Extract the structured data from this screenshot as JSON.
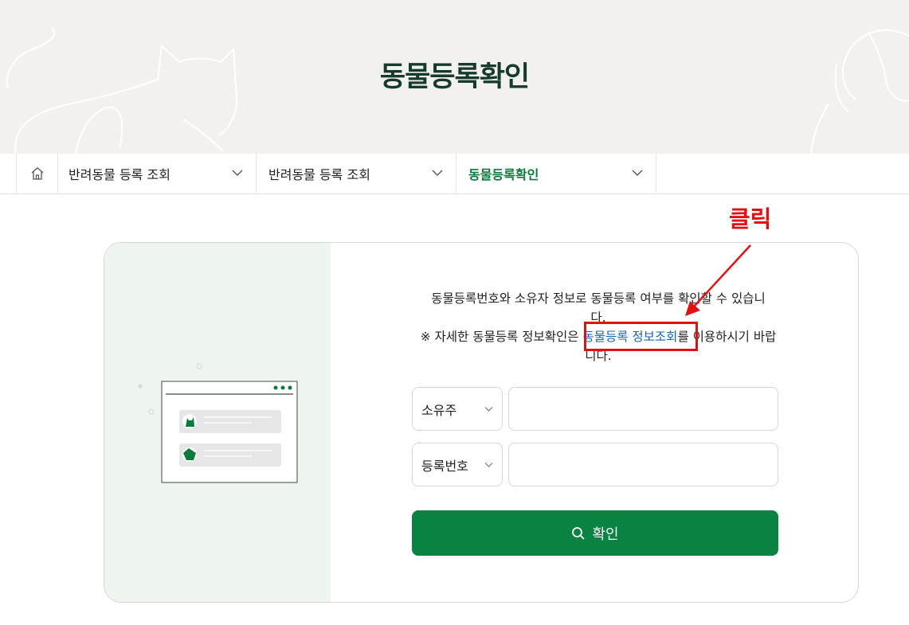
{
  "hero": {
    "title": "동물등록확인"
  },
  "breadcrumb": {
    "items": [
      {
        "label": "반려동물 등록 조회"
      },
      {
        "label": "반려동물 등록 조회"
      },
      {
        "label": "동물등록확인"
      }
    ]
  },
  "annotation": {
    "label": "클릭"
  },
  "card": {
    "description_line1": "동물등록번호와 소유자 정보로 동물등록 여부를 확인할 수 있습니다.",
    "description_prefix": "※ 자세한 동물등록 정보확인은 ",
    "description_link": "동물등록 정보조회",
    "description_suffix": "를 이용하시기 바랍니다."
  },
  "form": {
    "owner_select": "소유주",
    "reg_select": "등록번호",
    "owner_value": "",
    "reg_value": "",
    "submit_label": "확인"
  },
  "colors": {
    "accent": "#0a8242",
    "annotation": "#e21111",
    "link": "#1a62b8",
    "hero_bg": "#f2f1ed",
    "title": "#173a2e"
  }
}
